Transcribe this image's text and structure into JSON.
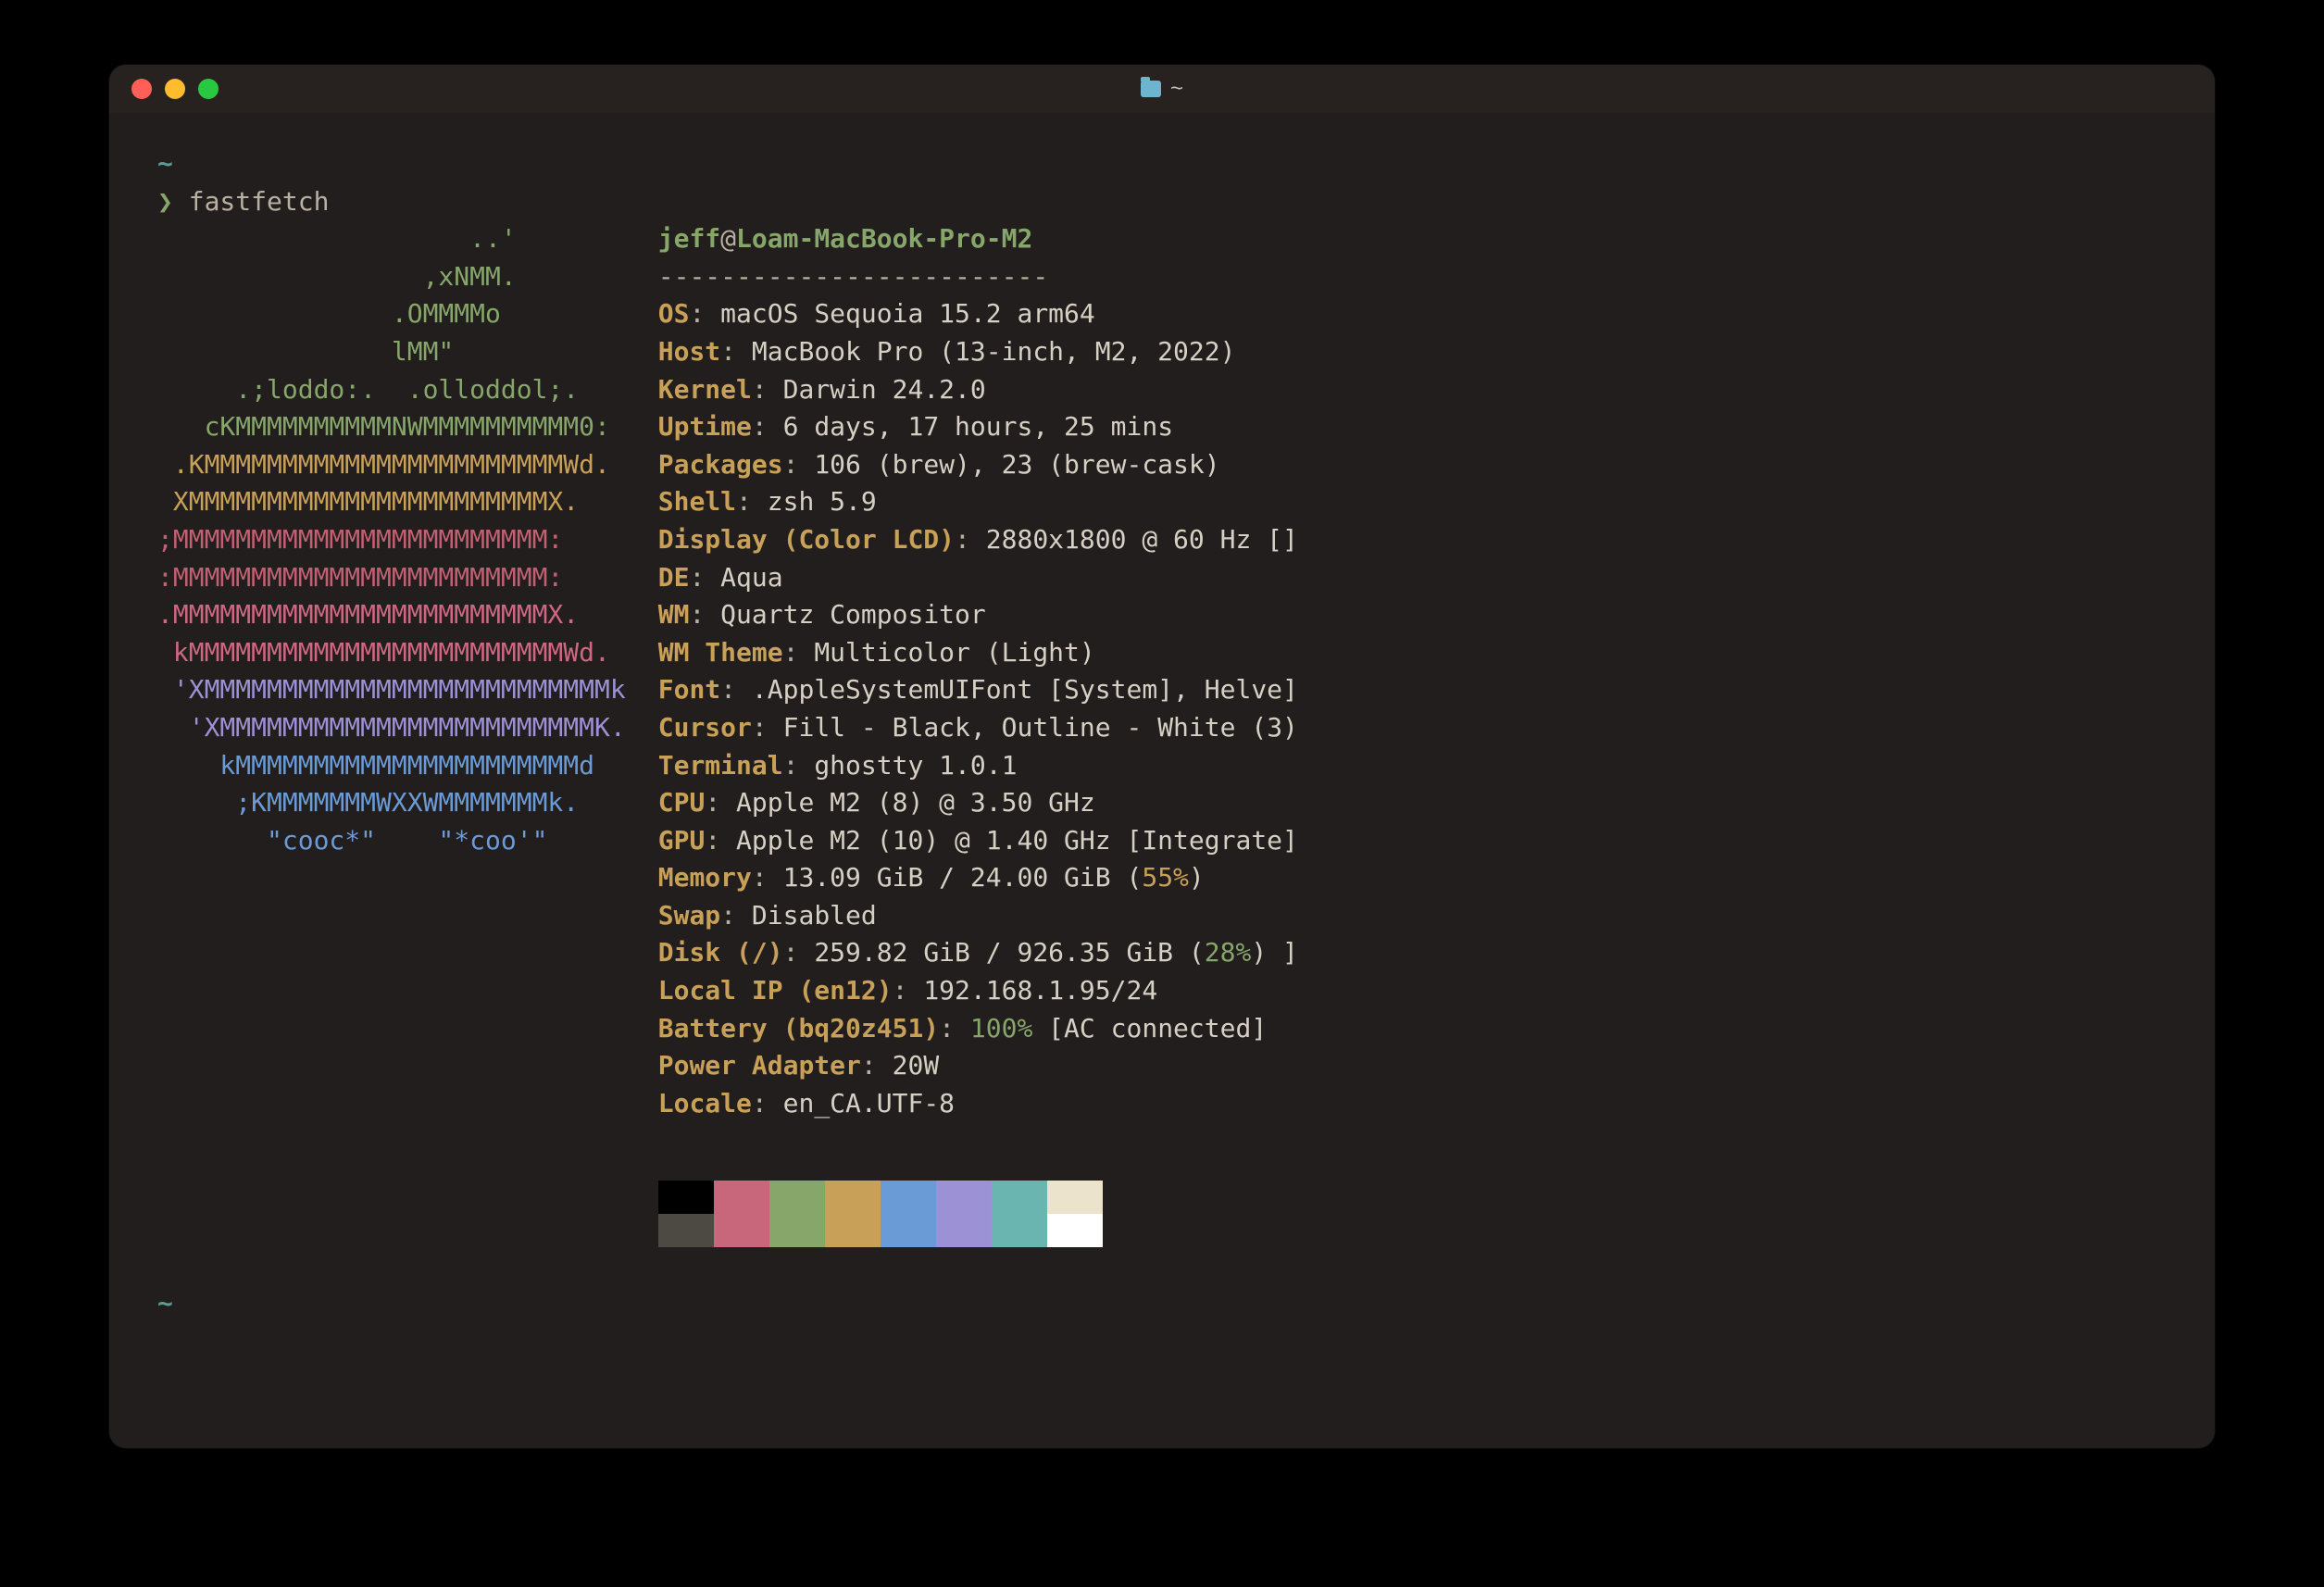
{
  "window": {
    "title_path": "~"
  },
  "prompt": {
    "tilde": "~",
    "char": "❯",
    "command": "fastfetch"
  },
  "logo": [
    {
      "t": "                    ..'",
      "c": "c-green"
    },
    {
      "t": "                 ,xNMM.",
      "c": "c-green"
    },
    {
      "t": "               .OMMMMo",
      "c": "c-green"
    },
    {
      "t": "               lMM\"",
      "c": "c-green"
    },
    {
      "t": "     .;loddo:.  .olloddol;.",
      "c": "c-green"
    },
    {
      "t": "   cKMMMMMMMMMMNWMMMMMMMMMM0:",
      "c": "c-green"
    },
    {
      "t": " .KMMMMMMMMMMMMMMMMMMMMMMMWd.",
      "c": "c-yellow"
    },
    {
      "t": " XMMMMMMMMMMMMMMMMMMMMMMMX.",
      "c": "c-yellow"
    },
    {
      "t": ";MMMMMMMMMMMMMMMMMMMMMMMM:",
      "c": "c-red"
    },
    {
      "t": ":MMMMMMMMMMMMMMMMMMMMMMMM:",
      "c": "c-red"
    },
    {
      "t": ".MMMMMMMMMMMMMMMMMMMMMMMMX.",
      "c": "c-pink"
    },
    {
      "t": " kMMMMMMMMMMMMMMMMMMMMMMMMWd.",
      "c": "c-pink"
    },
    {
      "t": " 'XMMMMMMMMMMMMMMMMMMMMMMMMMMk",
      "c": "c-purple"
    },
    {
      "t": "  'XMMMMMMMMMMMMMMMMMMMMMMMMK.",
      "c": "c-purple"
    },
    {
      "t": "    kMMMMMMMMMMMMMMMMMMMMMMd",
      "c": "c-blue"
    },
    {
      "t": "     ;KMMMMMMMWXXWMMMMMMMk.",
      "c": "c-blue"
    },
    {
      "t": "       \"cooc*\"    \"*coo'\"",
      "c": "c-blue"
    }
  ],
  "header": {
    "user": "jeff",
    "at": "@",
    "host": "Loam-MacBook-Pro-M2",
    "sep": "-------------------------"
  },
  "items": [
    {
      "label": "OS",
      "value": "macOS Sequoia 15.2 arm64"
    },
    {
      "label": "Host",
      "value": "MacBook Pro (13-inch, M2, 2022)"
    },
    {
      "label": "Kernel",
      "value": "Darwin 24.2.0"
    },
    {
      "label": "Uptime",
      "value": "6 days, 17 hours, 25 mins"
    },
    {
      "label": "Packages",
      "value": "106 (brew), 23 (brew-cask)"
    },
    {
      "label": "Shell",
      "value": "zsh 5.9"
    },
    {
      "label": "Display (Color LCD)",
      "value": "2880x1800 @ 60 Hz []"
    },
    {
      "label": "DE",
      "value": "Aqua"
    },
    {
      "label": "WM",
      "value": "Quartz Compositor"
    },
    {
      "label": "WM Theme",
      "value": "Multicolor (Light)"
    },
    {
      "label": "Font",
      "value": ".AppleSystemUIFont [System], Helve]"
    },
    {
      "label": "Cursor",
      "value": "Fill - Black, Outline - White (3)"
    },
    {
      "label": "Terminal",
      "value": "ghostty 1.0.1"
    },
    {
      "label": "CPU",
      "value": "Apple M2 (8) @ 3.50 GHz"
    },
    {
      "label": "GPU",
      "value": "Apple M2 (10) @ 1.40 GHz [Integrate]"
    }
  ],
  "memory": {
    "label": "Memory",
    "prefix": "13.09 GiB / 24.00 GiB (",
    "pct": "55%",
    "suffix": ")"
  },
  "swap": {
    "label": "Swap",
    "value": "Disabled"
  },
  "disk": {
    "label": "Disk (/)",
    "prefix": "259.82 GiB / 926.35 GiB (",
    "pct": "28%",
    "suffix": ") ]"
  },
  "localip": {
    "label": "Local IP (en12)",
    "value": "192.168.1.95/24"
  },
  "battery": {
    "label": "Battery (bq20z451)",
    "pct": "100%",
    "suffix": " [AC connected]"
  },
  "power": {
    "label": "Power Adapter",
    "value": "20W"
  },
  "locale": {
    "label": "Locale",
    "value": "en_CA.UTF-8"
  },
  "palette": {
    "row1": [
      "#000000",
      "#c8667c",
      "#86a66a",
      "#c8a057",
      "#6a9bd6",
      "#9d91d6",
      "#6ab5b0",
      "#ece3cd"
    ],
    "row2": [
      "#4d4a44",
      "#c8667c",
      "#86a66a",
      "#c8a057",
      "#6a9bd6",
      "#9d91d6",
      "#6ab5b0",
      "#ffffff"
    ]
  },
  "end_tilde": "~"
}
